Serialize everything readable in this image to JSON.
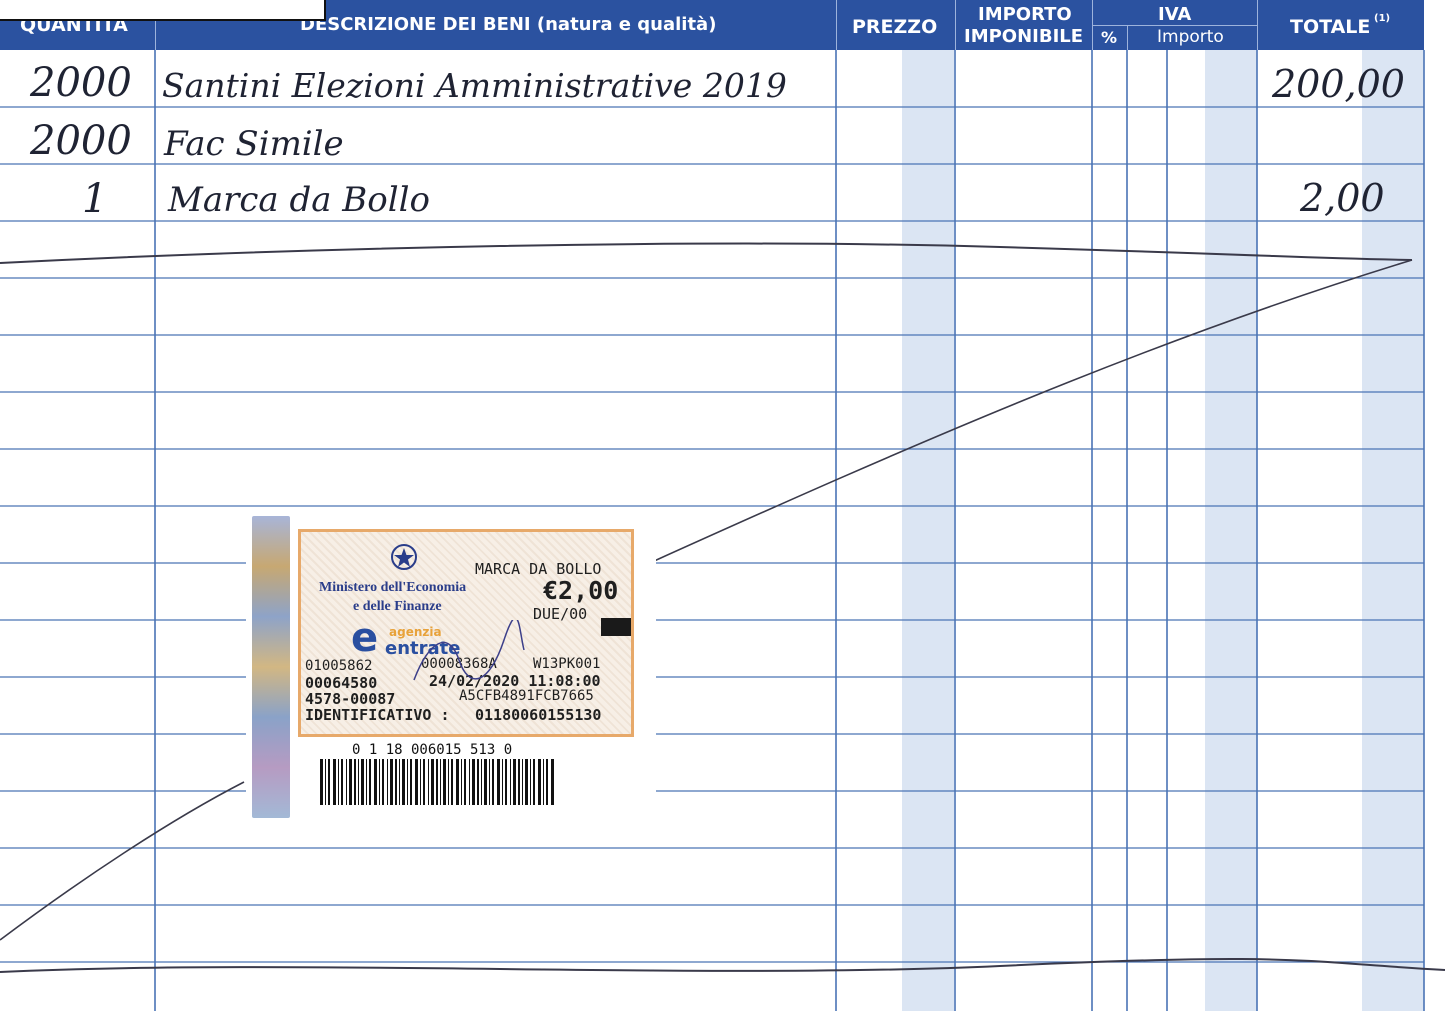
{
  "header": {
    "quantity": "QUANTITÀ",
    "description": "DESCRIZIONE DEI BENI (natura e qualità)",
    "price": "PREZZO",
    "taxable_line1": "IMPORTO",
    "taxable_line2": "IMPONIBILE",
    "vat": "IVA",
    "vat_percent": "%",
    "vat_amount": "Importo",
    "total": "TOTALE",
    "total_note": "(1)"
  },
  "rows": [
    {
      "quantity": "2000",
      "description": "Santini Elezioni Amministrative 2019",
      "total": "200,00"
    },
    {
      "quantity": "2000",
      "description": "Fac Simile",
      "total": ""
    },
    {
      "quantity": "1",
      "description": "Marca da Bollo",
      "total": "2,00"
    }
  ],
  "stamp": {
    "ministry_line1": "Ministero dell'Economia",
    "ministry_line2": "e delle Finanze",
    "agency_line1": "agenzia",
    "agency_line2": "entrate",
    "title": "MARCA DA BOLLO",
    "value": "€2,00",
    "value_words": "DUE/00",
    "code_a": "01005862",
    "code_b": "00008368A",
    "code_c": "W13PK001",
    "code_d": "00064580",
    "date_time": "24/02/2020 11:08:00",
    "code_e": "4578-00087",
    "code_f": "A5CFB4891FCB7665",
    "identifier_label": "IDENTIFICATIVO :",
    "identifier": "01180060155130",
    "barcode_text": "0 1 18 006015 513 0"
  },
  "colors": {
    "header_blue": "#2b52a0",
    "rule_blue": "#4a73b5",
    "band_blue": "#dbe5f3",
    "ink": "#1f2333"
  }
}
